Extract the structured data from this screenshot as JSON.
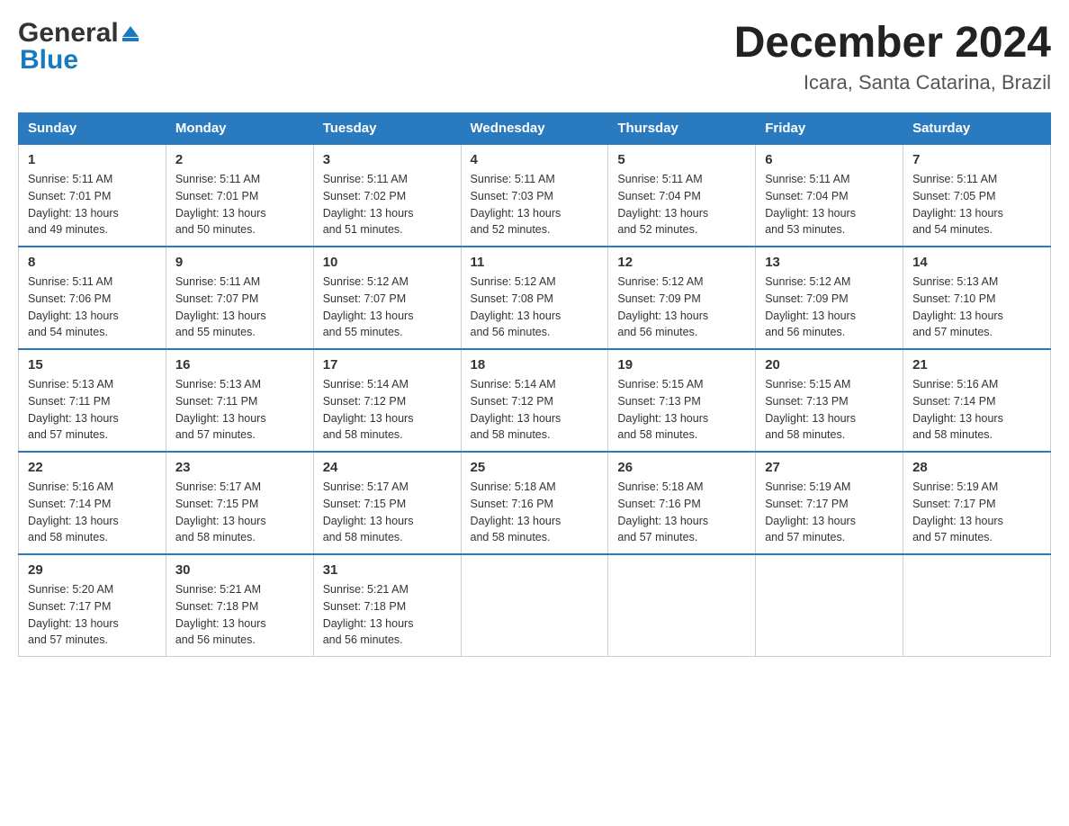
{
  "header": {
    "logo_general": "General",
    "logo_blue": "Blue",
    "title": "December 2024",
    "subtitle": "Icara, Santa Catarina, Brazil"
  },
  "weekdays": [
    "Sunday",
    "Monday",
    "Tuesday",
    "Wednesday",
    "Thursday",
    "Friday",
    "Saturday"
  ],
  "weeks": [
    [
      {
        "day": "1",
        "sunrise": "5:11 AM",
        "sunset": "7:01 PM",
        "daylight": "13 hours and 49 minutes."
      },
      {
        "day": "2",
        "sunrise": "5:11 AM",
        "sunset": "7:01 PM",
        "daylight": "13 hours and 50 minutes."
      },
      {
        "day": "3",
        "sunrise": "5:11 AM",
        "sunset": "7:02 PM",
        "daylight": "13 hours and 51 minutes."
      },
      {
        "day": "4",
        "sunrise": "5:11 AM",
        "sunset": "7:03 PM",
        "daylight": "13 hours and 52 minutes."
      },
      {
        "day": "5",
        "sunrise": "5:11 AM",
        "sunset": "7:04 PM",
        "daylight": "13 hours and 52 minutes."
      },
      {
        "day": "6",
        "sunrise": "5:11 AM",
        "sunset": "7:04 PM",
        "daylight": "13 hours and 53 minutes."
      },
      {
        "day": "7",
        "sunrise": "5:11 AM",
        "sunset": "7:05 PM",
        "daylight": "13 hours and 54 minutes."
      }
    ],
    [
      {
        "day": "8",
        "sunrise": "5:11 AM",
        "sunset": "7:06 PM",
        "daylight": "13 hours and 54 minutes."
      },
      {
        "day": "9",
        "sunrise": "5:11 AM",
        "sunset": "7:07 PM",
        "daylight": "13 hours and 55 minutes."
      },
      {
        "day": "10",
        "sunrise": "5:12 AM",
        "sunset": "7:07 PM",
        "daylight": "13 hours and 55 minutes."
      },
      {
        "day": "11",
        "sunrise": "5:12 AM",
        "sunset": "7:08 PM",
        "daylight": "13 hours and 56 minutes."
      },
      {
        "day": "12",
        "sunrise": "5:12 AM",
        "sunset": "7:09 PM",
        "daylight": "13 hours and 56 minutes."
      },
      {
        "day": "13",
        "sunrise": "5:12 AM",
        "sunset": "7:09 PM",
        "daylight": "13 hours and 56 minutes."
      },
      {
        "day": "14",
        "sunrise": "5:13 AM",
        "sunset": "7:10 PM",
        "daylight": "13 hours and 57 minutes."
      }
    ],
    [
      {
        "day": "15",
        "sunrise": "5:13 AM",
        "sunset": "7:11 PM",
        "daylight": "13 hours and 57 minutes."
      },
      {
        "day": "16",
        "sunrise": "5:13 AM",
        "sunset": "7:11 PM",
        "daylight": "13 hours and 57 minutes."
      },
      {
        "day": "17",
        "sunrise": "5:14 AM",
        "sunset": "7:12 PM",
        "daylight": "13 hours and 58 minutes."
      },
      {
        "day": "18",
        "sunrise": "5:14 AM",
        "sunset": "7:12 PM",
        "daylight": "13 hours and 58 minutes."
      },
      {
        "day": "19",
        "sunrise": "5:15 AM",
        "sunset": "7:13 PM",
        "daylight": "13 hours and 58 minutes."
      },
      {
        "day": "20",
        "sunrise": "5:15 AM",
        "sunset": "7:13 PM",
        "daylight": "13 hours and 58 minutes."
      },
      {
        "day": "21",
        "sunrise": "5:16 AM",
        "sunset": "7:14 PM",
        "daylight": "13 hours and 58 minutes."
      }
    ],
    [
      {
        "day": "22",
        "sunrise": "5:16 AM",
        "sunset": "7:14 PM",
        "daylight": "13 hours and 58 minutes."
      },
      {
        "day": "23",
        "sunrise": "5:17 AM",
        "sunset": "7:15 PM",
        "daylight": "13 hours and 58 minutes."
      },
      {
        "day": "24",
        "sunrise": "5:17 AM",
        "sunset": "7:15 PM",
        "daylight": "13 hours and 58 minutes."
      },
      {
        "day": "25",
        "sunrise": "5:18 AM",
        "sunset": "7:16 PM",
        "daylight": "13 hours and 58 minutes."
      },
      {
        "day": "26",
        "sunrise": "5:18 AM",
        "sunset": "7:16 PM",
        "daylight": "13 hours and 57 minutes."
      },
      {
        "day": "27",
        "sunrise": "5:19 AM",
        "sunset": "7:17 PM",
        "daylight": "13 hours and 57 minutes."
      },
      {
        "day": "28",
        "sunrise": "5:19 AM",
        "sunset": "7:17 PM",
        "daylight": "13 hours and 57 minutes."
      }
    ],
    [
      {
        "day": "29",
        "sunrise": "5:20 AM",
        "sunset": "7:17 PM",
        "daylight": "13 hours and 57 minutes."
      },
      {
        "day": "30",
        "sunrise": "5:21 AM",
        "sunset": "7:18 PM",
        "daylight": "13 hours and 56 minutes."
      },
      {
        "day": "31",
        "sunrise": "5:21 AM",
        "sunset": "7:18 PM",
        "daylight": "13 hours and 56 minutes."
      },
      null,
      null,
      null,
      null
    ]
  ],
  "labels": {
    "sunrise": "Sunrise:",
    "sunset": "Sunset:",
    "daylight": "Daylight:"
  }
}
